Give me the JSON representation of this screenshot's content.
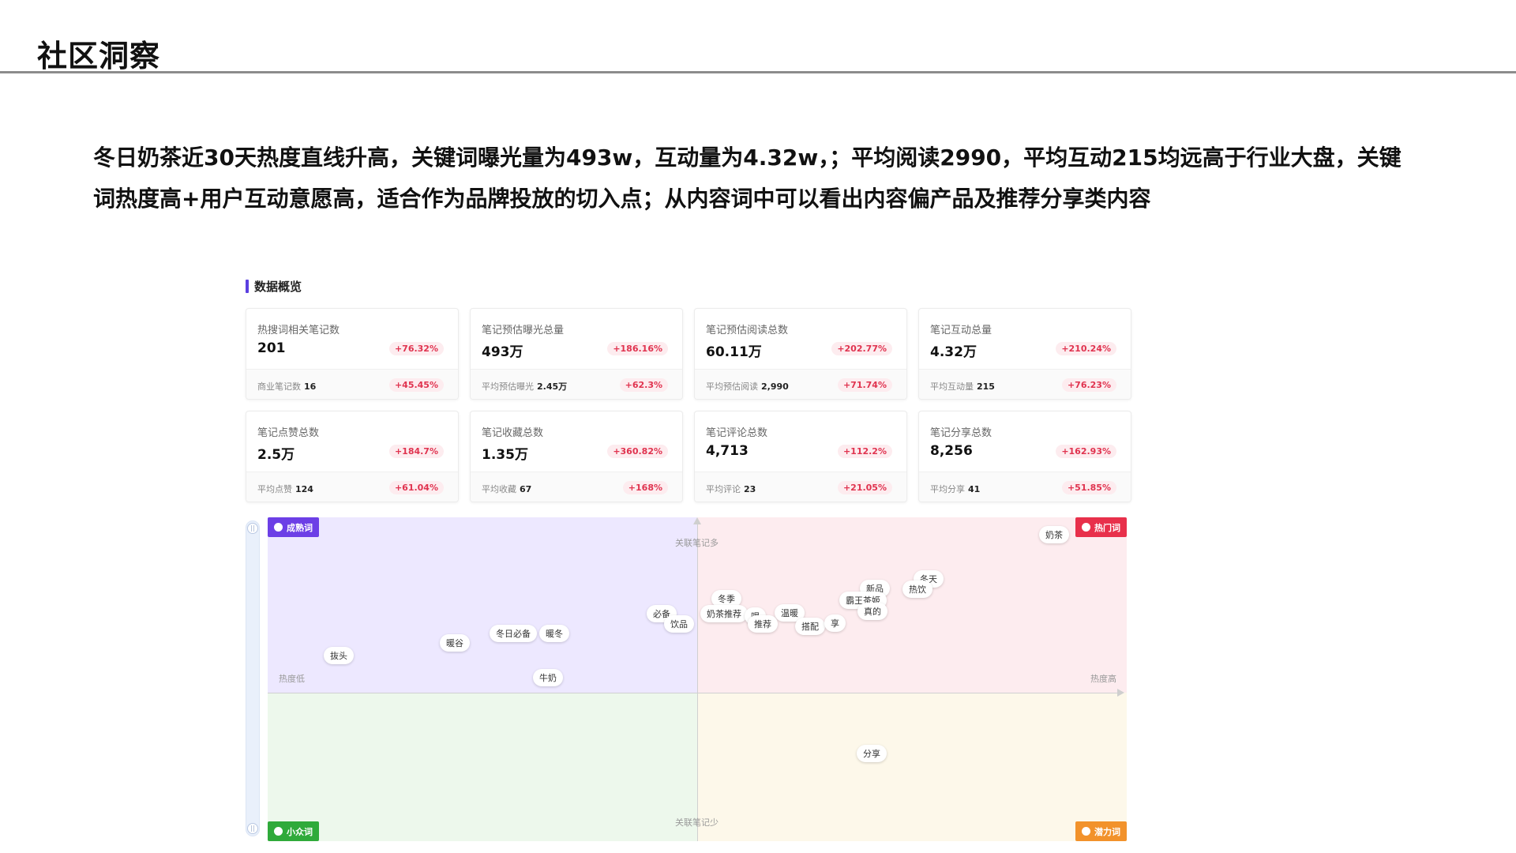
{
  "page": {
    "title": "社区洞察",
    "summary": "冬日奶茶近30天热度直线升高，关键词曝光量为493w，互动量为4.32w，；平均阅读2990，平均互动215均远高于行业大盘，关键词热度高+用户互动意愿高，适合作为品牌投放的切入点；从内容词中可以看出内容偏产品及推荐分享类内容"
  },
  "overview": {
    "section_label": "数据概览",
    "cards": [
      {
        "label": "热搜词相关笔记数",
        "value": "201",
        "change": "+76.32%",
        "sub_label": "商业笔记数",
        "sub_value": "16",
        "sub_change": "+45.45%"
      },
      {
        "label": "笔记预估曝光总量",
        "value": "493万",
        "change": "+186.16%",
        "sub_label": "平均预估曝光",
        "sub_value": "2.45万",
        "sub_change": "+62.3%"
      },
      {
        "label": "笔记预估阅读总数",
        "value": "60.11万",
        "change": "+202.77%",
        "sub_label": "平均预估阅读",
        "sub_value": "2,990",
        "sub_change": "+71.74%"
      },
      {
        "label": "笔记互动总量",
        "value": "4.32万",
        "change": "+210.24%",
        "sub_label": "平均互动量",
        "sub_value": "215",
        "sub_change": "+76.23%"
      },
      {
        "label": "笔记点赞总数",
        "value": "2.5万",
        "change": "+184.7%",
        "sub_label": "平均点赞",
        "sub_value": "124",
        "sub_change": "+61.04%"
      },
      {
        "label": "笔记收藏总数",
        "value": "1.35万",
        "change": "+360.82%",
        "sub_label": "平均收藏",
        "sub_value": "67",
        "sub_change": "+168%"
      },
      {
        "label": "笔记评论总数",
        "value": "4,713",
        "change": "+112.2%",
        "sub_label": "平均评论",
        "sub_value": "23",
        "sub_change": "+21.05%"
      },
      {
        "label": "笔记分享总数",
        "value": "8,256",
        "change": "+162.93%",
        "sub_label": "平均分享",
        "sub_value": "41",
        "sub_change": "+51.85%"
      }
    ]
  },
  "quadrant": {
    "tags": {
      "mature": "成熟词",
      "hot": "热门词",
      "niche": "小众词",
      "potential": "潜力词"
    },
    "axis": {
      "top": "关联笔记多",
      "bottom": "关联笔记少",
      "left": "热度低",
      "right": "热度高"
    },
    "scroll_knob": "||",
    "words": [
      {
        "text": "奶茶"
      },
      {
        "text": "冬天"
      },
      {
        "text": "新品"
      },
      {
        "text": "热饮"
      },
      {
        "text": "霸王茶姬"
      },
      {
        "text": "真的"
      },
      {
        "text": "冬季"
      },
      {
        "text": "必备"
      },
      {
        "text": "饮品"
      },
      {
        "text": "奶茶推荐"
      },
      {
        "text": "喝"
      },
      {
        "text": "温暖"
      },
      {
        "text": "推荐"
      },
      {
        "text": "搭配"
      },
      {
        "text": "享"
      },
      {
        "text": "冬日必备"
      },
      {
        "text": "暖冬"
      },
      {
        "text": "暖谷"
      },
      {
        "text": "抜头"
      },
      {
        "text": "牛奶"
      },
      {
        "text": "分享"
      }
    ]
  },
  "colors": {
    "accent": "#5b3fe0",
    "change_red": "#e0334f",
    "mature": "#6c3fe6",
    "hot": "#e8304b",
    "niche": "#2faa3a",
    "potential": "#f2922b"
  }
}
